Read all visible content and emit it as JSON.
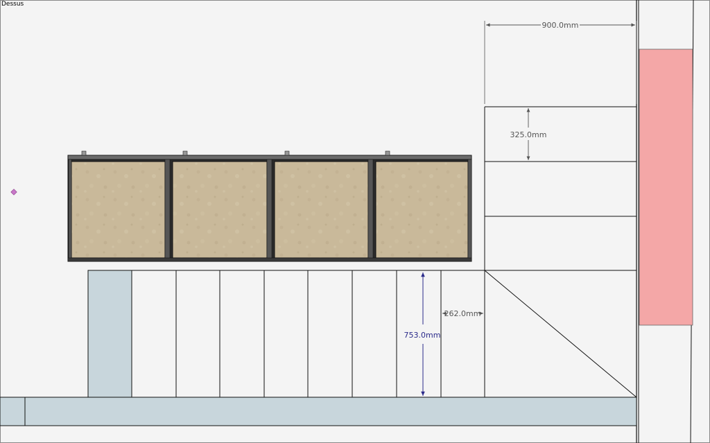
{
  "view": {
    "label": "Dessus"
  },
  "dimensions": {
    "top_width": "900.0mm",
    "shelf_height": "325.0mm",
    "cabinet_height": "753.0mm",
    "cabinet_depth": "262.0mm"
  },
  "colors": {
    "background": "#f4f4f4",
    "line": "#111111",
    "panel_blue": "#c8d6dc",
    "panel_pink": "#f4a7a7",
    "fabric": "#c9b99a",
    "dimension_gray": "#555555",
    "dimension_blue": "#2a2a8a",
    "axis_marker": "#c878c8"
  }
}
